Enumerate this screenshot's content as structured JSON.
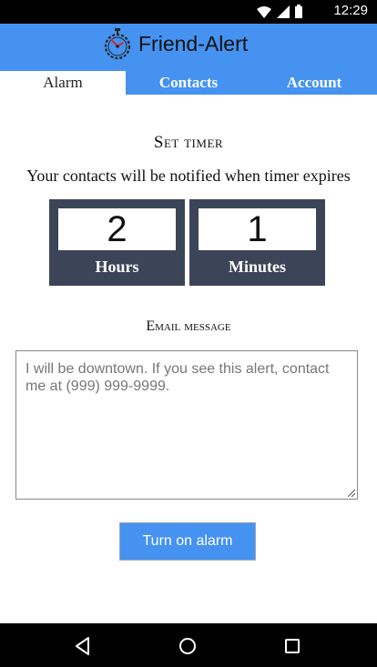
{
  "status_bar": {
    "time": "12:29",
    "icons": [
      "wifi-icon",
      "signal-icon",
      "battery-icon"
    ]
  },
  "app": {
    "title": "Friend-Alert",
    "logo_icon": "stopwatch-icon",
    "accent_color": "#4592f0",
    "panel_color": "#3c4458"
  },
  "tabs": [
    {
      "label": "Alarm",
      "active": true
    },
    {
      "label": "Contacts",
      "active": false
    },
    {
      "label": "Account",
      "active": false
    }
  ],
  "timer": {
    "heading": "Set timer",
    "subtitle": "Your contacts will be notified when timer expires",
    "hours": {
      "value": "2",
      "label": "Hours"
    },
    "minutes": {
      "value": "1",
      "label": "Minutes"
    }
  },
  "email": {
    "label": "Email message",
    "message": "I will be downtown. If you see this alert, contact me at (999) 999-9999."
  },
  "action": {
    "button_label": "Turn on alarm"
  },
  "navbar": {
    "icons": [
      "back-icon",
      "home-icon",
      "recent-apps-icon"
    ]
  }
}
